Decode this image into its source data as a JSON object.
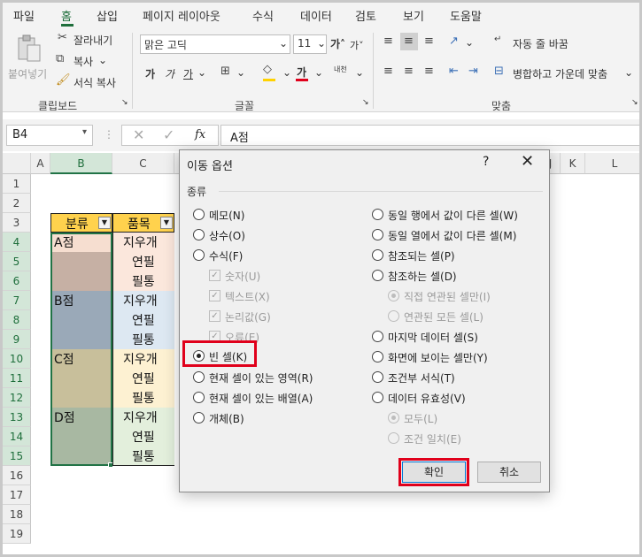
{
  "menu": [
    "파일",
    "홈",
    "삽입",
    "페이지 레이아웃",
    "수식",
    "데이터",
    "검토",
    "보기",
    "도움말"
  ],
  "ribbon": {
    "clipboard": {
      "paste": "붙여넣기",
      "cut": "잘라내기",
      "copy": "복사",
      "format_painter": "서식 복사",
      "label": "클립보드"
    },
    "font": {
      "name": "맑은 고딕",
      "size": "11",
      "bold": "가",
      "italic": "가",
      "underline": "가",
      "label": "글꼴",
      "font_color_glyph": "가",
      "phonetic": "내천"
    },
    "alignment": {
      "wrap": "자동 줄 바꿈",
      "merge": "병합하고 가운데 맞춤",
      "label": "맞춤"
    }
  },
  "formula_bar": {
    "name_box": "B4",
    "fx": "fx",
    "value": "A점"
  },
  "grid": {
    "columns": [
      "A",
      "B",
      "C",
      "I",
      "J",
      "K",
      "L"
    ],
    "rows": [
      "1",
      "2",
      "3",
      "4",
      "5",
      "6",
      "7",
      "8",
      "9",
      "10",
      "11",
      "12",
      "13",
      "14",
      "15",
      "16",
      "17",
      "18",
      "19"
    ],
    "header_b": "분류",
    "header_c": "품목",
    "b_values": [
      "A점",
      "B점",
      "C점",
      "D점"
    ],
    "c_values": [
      "지우개",
      "연필",
      "필통",
      "지우개",
      "연필",
      "필통",
      "지우개",
      "연필",
      "필통",
      "지우개",
      "연필",
      "필통"
    ]
  },
  "dialog": {
    "title": "이동 옵션",
    "help": "?",
    "close": "✕",
    "group": "종류",
    "left_options": [
      "메모(N)",
      "상수(O)",
      "수식(F)",
      "숫자(U)",
      "텍스트(X)",
      "논리값(G)",
      "오류(E)",
      "빈 셀(K)",
      "현재 셀이 있는 영역(R)",
      "현재 셀이 있는 배열(A)",
      "개체(B)"
    ],
    "right_options": [
      "동일 행에서 값이 다른 셀(W)",
      "동일 열에서 값이 다른 셀(M)",
      "참조되는 셀(P)",
      "참조하는 셀(D)",
      "직접 연관된 셀만(I)",
      "연관된 모든 셀(L)",
      "마지막 데이터 셀(S)",
      "화면에 보이는 셀만(Y)",
      "조건부 서식(T)",
      "데이터 유효성(V)",
      "모두(L)",
      "조건 일치(E)"
    ],
    "ok": "확인",
    "cancel": "취소"
  },
  "colors": {
    "accent": "#1e6e3b",
    "highlight": "#e0001b",
    "header_fill": "#ffd24d",
    "band_a": "#c6b0a4",
    "band_b": "#9aa9b8",
    "band_c": "#c8bf9b",
    "band_d": "#a8b8a2"
  }
}
